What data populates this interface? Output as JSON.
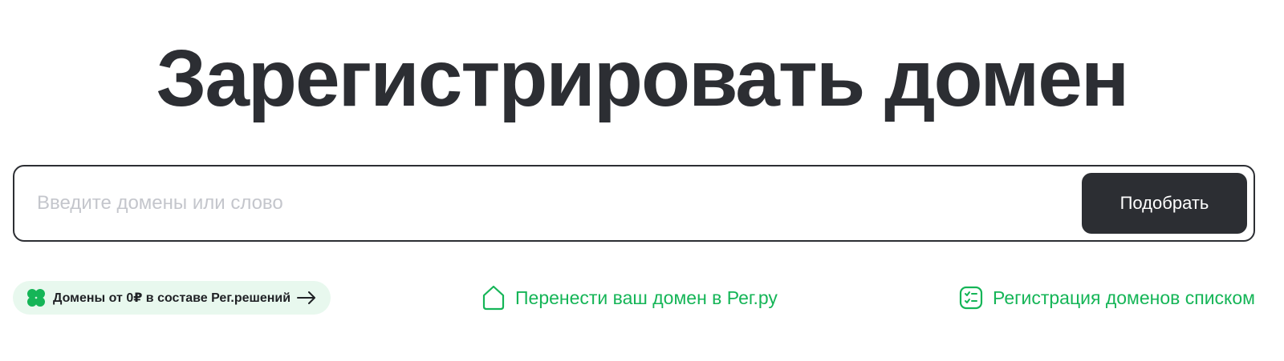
{
  "heading": "Зарегистрировать домен",
  "search": {
    "placeholder": "Введите домены или слово",
    "value": "",
    "submit_label": "Подобрать"
  },
  "promo": {
    "label": "Домены от 0₽ в составе Рег.решений",
    "icon": "clover-icon",
    "arrow_icon": "arrow-right-icon"
  },
  "links": {
    "transfer": {
      "label": "Перенести ваш домен в Рег.ру",
      "icon": "house-icon"
    },
    "bulk": {
      "label": "Регистрация доменов списком",
      "icon": "checklist-icon"
    }
  },
  "colors": {
    "text_dark": "#2c2e33",
    "accent_green": "#15b557",
    "promo_bg": "#e8f8ee",
    "placeholder": "#c4c6cc"
  }
}
